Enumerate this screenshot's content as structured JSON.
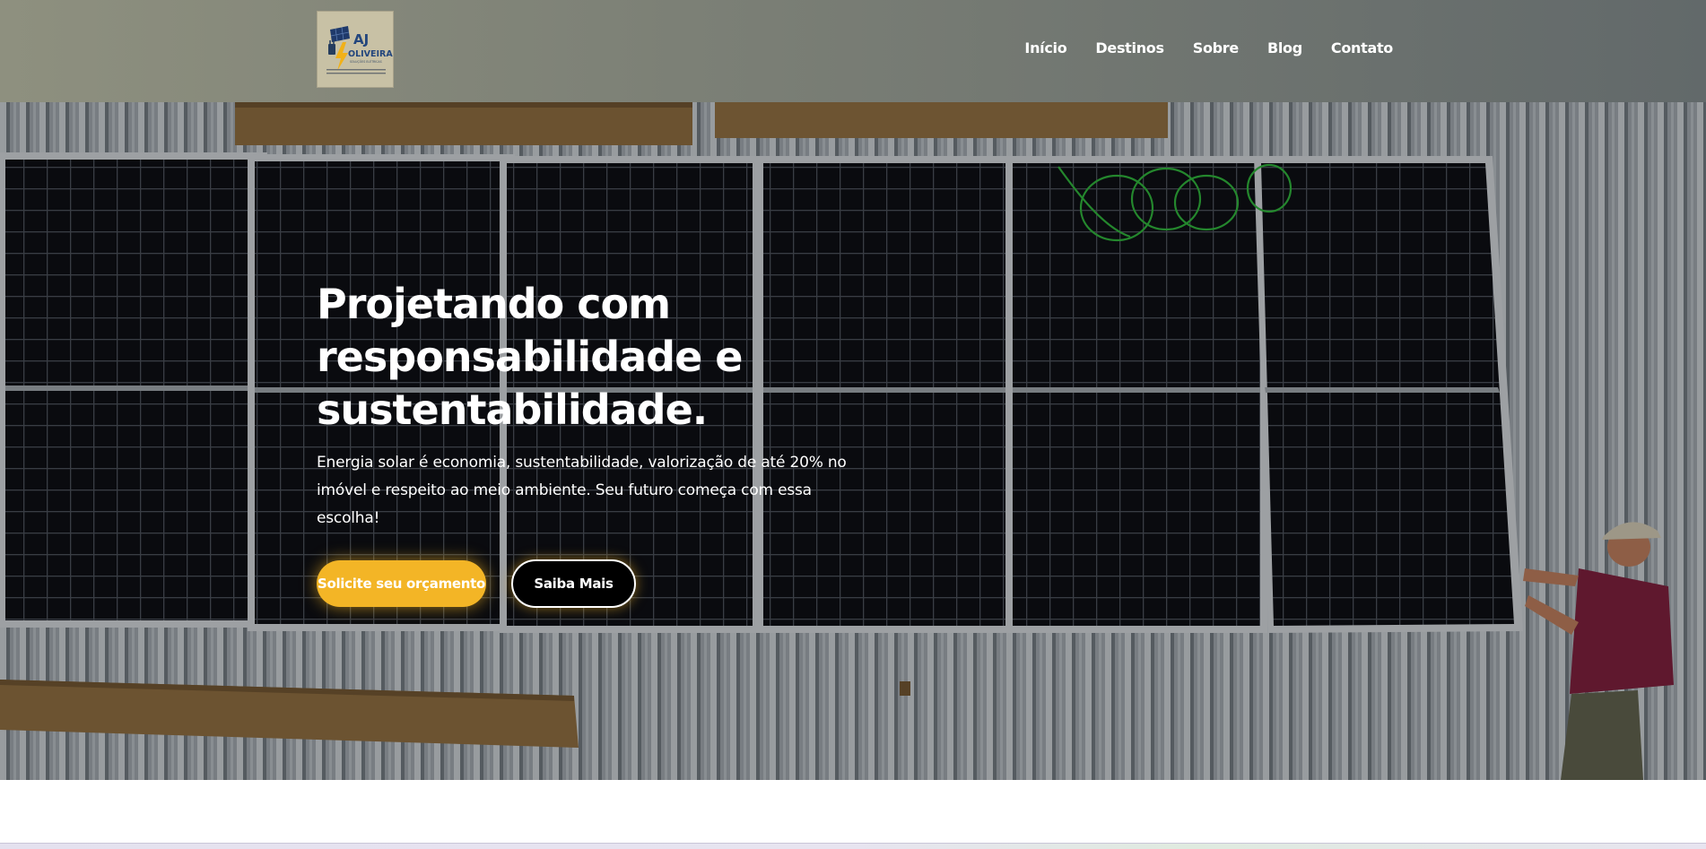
{
  "header": {
    "logo": {
      "icon": "solar-bolt-logo",
      "title": "AJ",
      "subtitle": "OLIVEIRA",
      "tagline": "SOLUÇÕES ELÉTRICAS"
    },
    "nav": [
      {
        "label": "Início"
      },
      {
        "label": "Destinos"
      },
      {
        "label": "Sobre"
      },
      {
        "label": "Blog"
      },
      {
        "label": "Contato"
      }
    ]
  },
  "hero": {
    "title": "Projetando com responsabilidade e sustentabilidade.",
    "text": "Energia solar é economia, sustentabilidade, valorização de até 20% no imóvel e respeito ao meio ambiente. Seu futuro começa com essa escolha!",
    "primary_button": "Solicite seu orçamento",
    "secondary_button": "Saiba Mais"
  },
  "colors": {
    "accent": "#f3b526",
    "header_from": "#8e907f",
    "header_to": "#62696a"
  }
}
